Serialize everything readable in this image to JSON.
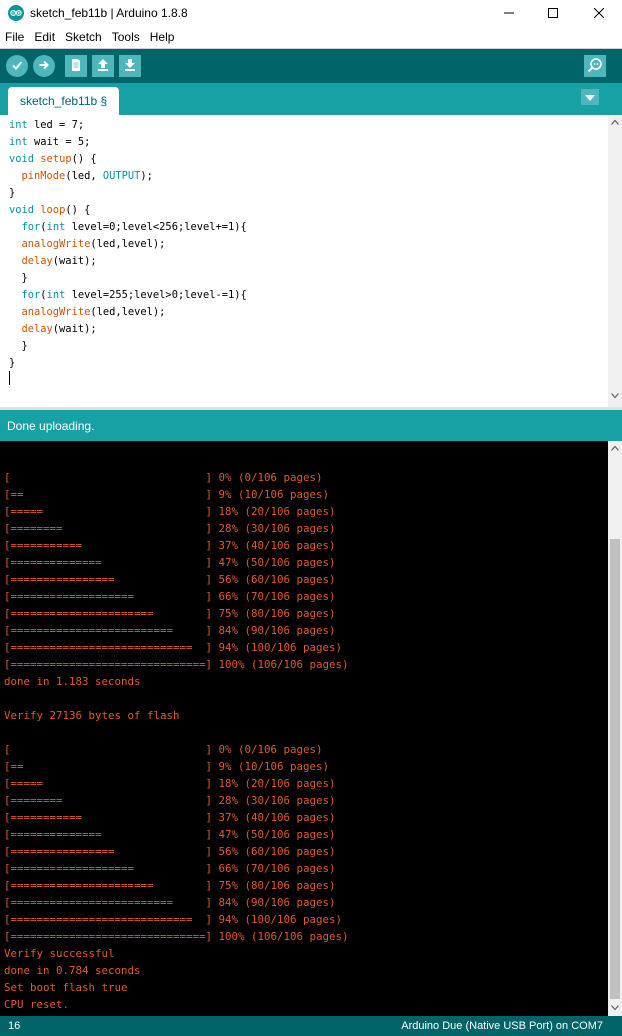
{
  "window": {
    "title": "sketch_feb11b | Arduino 1.8.8"
  },
  "menu": {
    "items": [
      "File",
      "Edit",
      "Sketch",
      "Tools",
      "Help"
    ]
  },
  "toolbar": {
    "buttons": [
      "verify-icon",
      "upload-icon",
      "new-icon",
      "open-icon",
      "save-icon",
      "serial-monitor-icon"
    ]
  },
  "tabs": {
    "active": "sketch_feb11b §"
  },
  "editor": {
    "lines": [
      "int led = 7;",
      "int wait = 5;",
      "void setup() {",
      "  pinMode(led, OUTPUT);",
      "}",
      "void loop() {",
      "  for(int level=0;level<256;level+=1){",
      "  analogWrite(led,level);",
      "  delay(wait);",
      "  }",
      "  for(int level=255;level>0;level-=1){",
      "  analogWrite(led,level);",
      "  delay(wait);",
      "  }",
      "}"
    ]
  },
  "status": {
    "message": "Done uploading."
  },
  "console": {
    "lines": [
      "",
      "[                              ] 0% (0/106 pages)",
      "[==                            ] 9% (10/106 pages)",
      "[=====                         ] 18% (20/106 pages)",
      "[========                      ] 28% (30/106 pages)",
      "[===========                   ] 37% (40/106 pages)",
      "[==============                ] 47% (50/106 pages)",
      "[================              ] 56% (60/106 pages)",
      "[===================           ] 66% (70/106 pages)",
      "[======================        ] 75% (80/106 pages)",
      "[=========================     ] 84% (90/106 pages)",
      "[============================  ] 94% (100/106 pages)",
      "[==============================] 100% (106/106 pages)",
      "done in 1.183 seconds",
      "",
      "Verify 27136 bytes of flash",
      "",
      "[                              ] 0% (0/106 pages)",
      "[==                            ] 9% (10/106 pages)",
      "[=====                         ] 18% (20/106 pages)",
      "[========                      ] 28% (30/106 pages)",
      "[===========                   ] 37% (40/106 pages)",
      "[==============                ] 47% (50/106 pages)",
      "[================              ] 56% (60/106 pages)",
      "[===================           ] 66% (70/106 pages)",
      "[======================        ] 75% (80/106 pages)",
      "[=========================     ] 84% (90/106 pages)",
      "[============================  ] 94% (100/106 pages)",
      "[==============================] 100% (106/106 pages)",
      "Verify successful",
      "done in 0.784 seconds",
      "Set boot flash true",
      "CPU reset."
    ]
  },
  "bottom": {
    "line_number": "16",
    "board": "Arduino Due (Native USB Port) on COM7"
  },
  "colors": {
    "toolbar": "#006468",
    "tabstrip": "#17a1a5",
    "button": "#4db7bb",
    "console_text": "#e05a2a",
    "keyword": "#00979c",
    "function": "#d35400"
  }
}
